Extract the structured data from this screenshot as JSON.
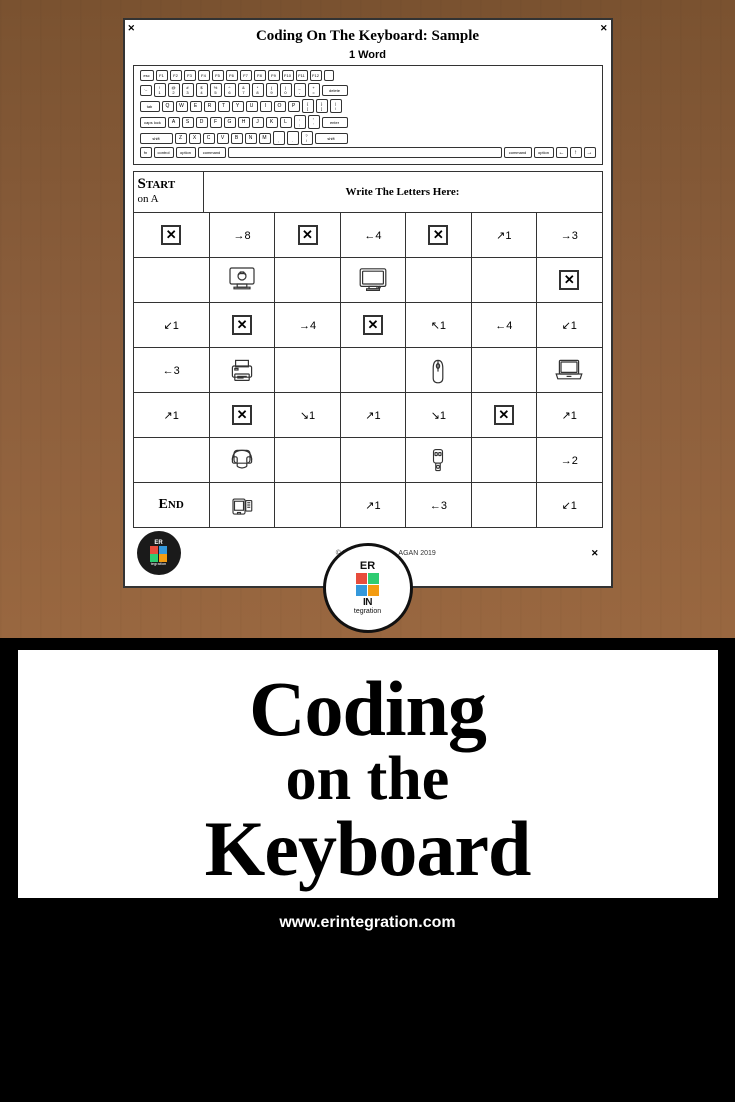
{
  "worksheet": {
    "title": "Coding On The Keyboard: Sample",
    "word_label": "1 Word",
    "write_here": "Write The Letters Here:",
    "start_label": "Start",
    "start_sub": "on A",
    "end_label": "End",
    "copyright": "© ERINTEGR",
    "year": "AGAN 2019"
  },
  "grid": {
    "rows": [
      [
        "X",
        "→8",
        "X",
        "←4",
        "X",
        "↗1",
        "→3"
      ],
      [
        "↙1",
        "X",
        "→4",
        "X",
        "↖1",
        "←4",
        "↙1"
      ],
      [
        "←3",
        "printer",
        "",
        "",
        "mouse",
        "",
        "laptop"
      ],
      [
        "↗1",
        "X",
        "↘1",
        "↗1",
        "↘1",
        "X",
        "↗1"
      ],
      [
        "END",
        "",
        "",
        "↗1",
        "←3",
        "↙1"
      ]
    ]
  },
  "bottom": {
    "line1": "Coding",
    "line2": "on the",
    "line3": "Keyboard",
    "website": "www.erintegration.com"
  },
  "keyboard": {
    "row1": [
      "esc",
      "F1",
      "F2",
      "F3",
      "F4",
      "F5",
      "F6",
      "F7",
      "F8",
      "F9",
      "F10",
      "F11",
      "F12",
      ""
    ],
    "row2": [
      "`~",
      "1!",
      "2@",
      "3#",
      "4$",
      "5%",
      "6^",
      "7&",
      "8*",
      "9(",
      "0)",
      "-_",
      "=+",
      "delete"
    ],
    "row3": [
      "tab",
      "Q",
      "W",
      "E",
      "R",
      "T",
      "Y",
      "U",
      "I",
      "O",
      "P",
      "[{",
      "]}",
      "\\|"
    ],
    "row4": [
      "caps lock",
      "A",
      "S",
      "D",
      "F",
      "G",
      "H",
      "J",
      "K",
      "L",
      ";:",
      "'\"",
      "enter"
    ],
    "row5": [
      "shift",
      "Z",
      "X",
      "C",
      "V",
      "B",
      "N",
      "M",
      ",<",
      ".>",
      "/?",
      "shift"
    ],
    "row6": [
      "fn",
      "control",
      "option",
      "command",
      "",
      "command",
      "option",
      "-",
      "↑",
      "-"
    ],
    "row7": [
      "←",
      "↓",
      "→"
    ]
  }
}
